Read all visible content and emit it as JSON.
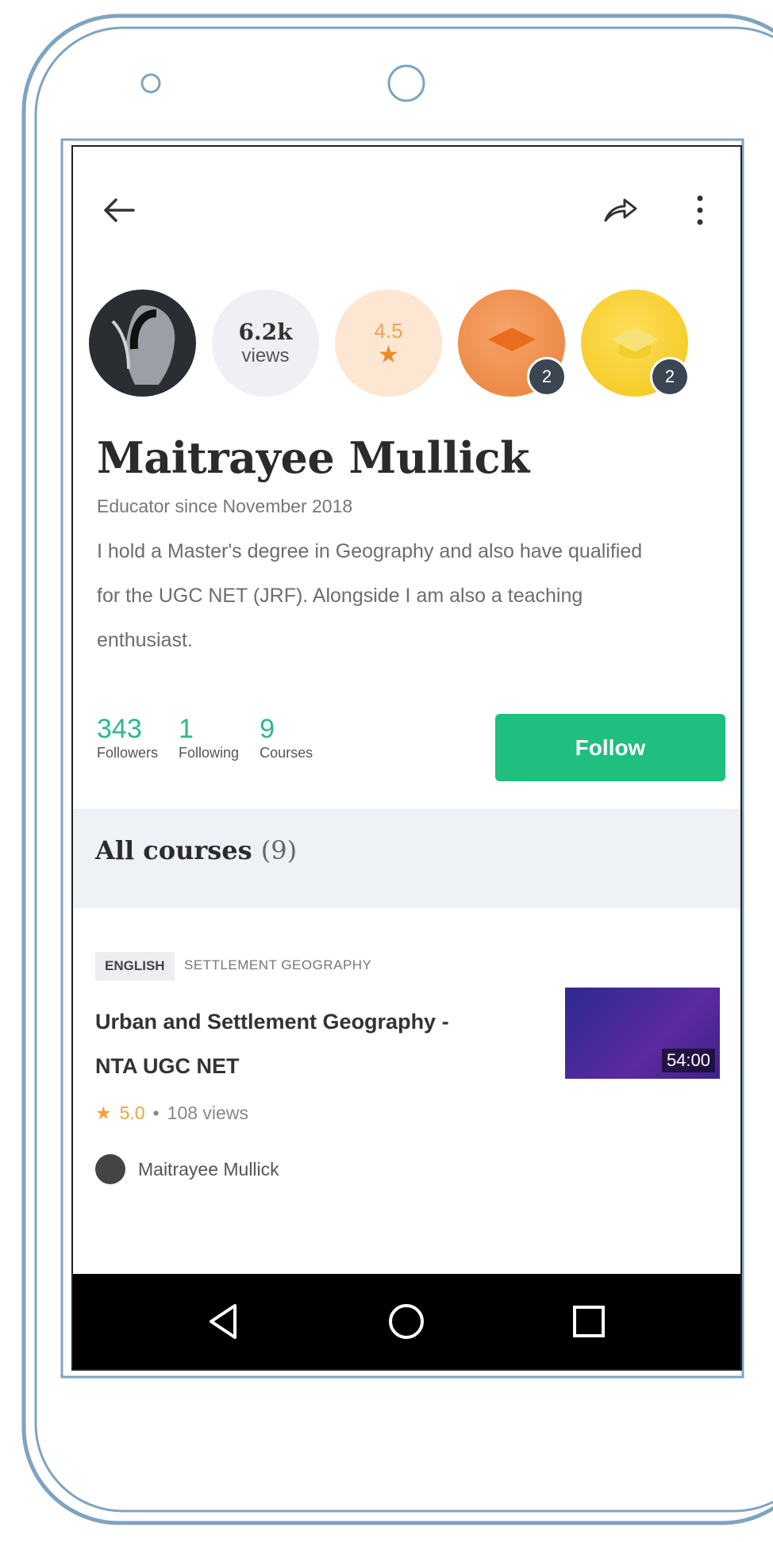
{
  "profile": {
    "views_count": "6.2k",
    "views_label": "views",
    "rating": "4.5",
    "badge_orange_count": "2",
    "badge_yellow_count": "2",
    "name": "Maitrayee Mullick",
    "since": "Educator since November 2018",
    "bio": "I hold a Master's degree in Geography  and also have qualified for the UGC NET (JRF). Alongside I am also a teaching enthusiast."
  },
  "stats": {
    "followers": {
      "value": "343",
      "label": "Followers"
    },
    "following": {
      "value": "1",
      "label": "Following"
    },
    "courses": {
      "value": "9",
      "label": "Courses"
    }
  },
  "follow_label": "Follow",
  "courses_section": {
    "title": "All courses",
    "count": "(9)"
  },
  "course_card": {
    "language_tag": "ENGLISH",
    "topic_tag": "SETTLEMENT GEOGRAPHY",
    "title": "Urban and Settlement Geography - NTA UGC NET",
    "rating": "5.0",
    "separator": "•",
    "views": "108 views",
    "duration": "54:00",
    "author": "Maitrayee Mullick"
  },
  "icons": {
    "back": "back-arrow-icon",
    "share": "share-icon",
    "more": "more-vertical-icon",
    "nav_back": "nav-back-icon",
    "nav_home": "nav-home-icon",
    "nav_recent": "nav-recent-icon"
  },
  "colors": {
    "accent_green": "#1fbf7f",
    "stat_green": "#2db88a",
    "star_orange": "#f08a24"
  }
}
